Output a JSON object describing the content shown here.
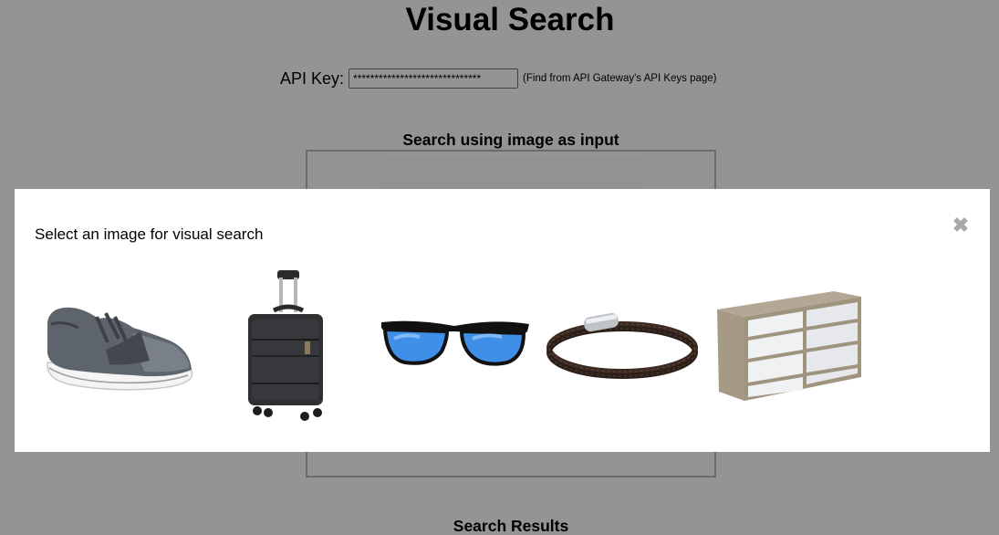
{
  "page": {
    "title": "Visual Search"
  },
  "api": {
    "label": "API Key:",
    "value": "******************************",
    "hint": "(Find from API Gateway's API Keys page)"
  },
  "search": {
    "section_title": "Search using image as input"
  },
  "results": {
    "section_title": "Search Results"
  },
  "modal": {
    "heading": "Select an image for visual search",
    "close_symbol": "✖",
    "images": [
      {
        "name": "sneaker-icon"
      },
      {
        "name": "suitcase-icon"
      },
      {
        "name": "sunglasses-icon"
      },
      {
        "name": "leather-bracelet-icon"
      },
      {
        "name": "dresser-icon"
      }
    ]
  },
  "colors": {
    "overlay": "#000000",
    "overlay_opacity": "0.42",
    "modal_background": "#ffffff",
    "close_icon": "#a9a9a9",
    "sunglasses_lens": "#3f8fe8"
  }
}
